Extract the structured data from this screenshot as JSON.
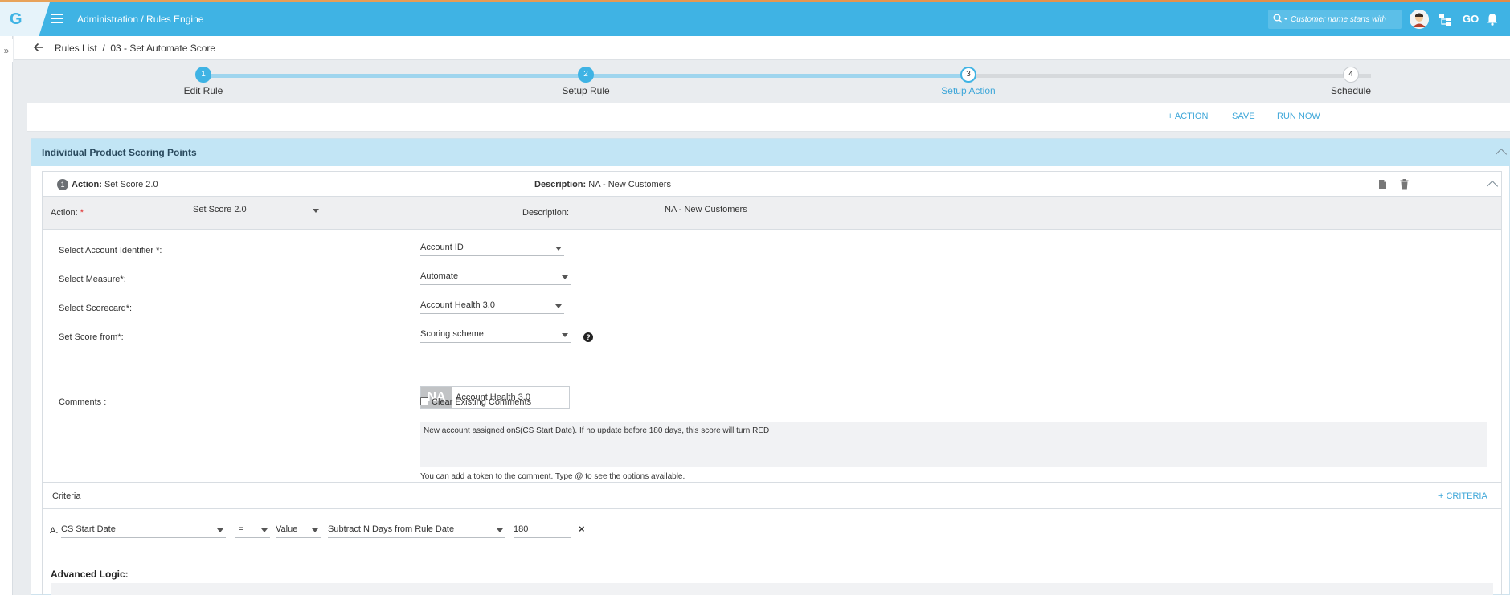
{
  "header": {
    "logo": "G",
    "breadcrumb": "Administration / Rules Engine",
    "search_placeholder": "Customer name starts with",
    "go_label": "GO"
  },
  "breadcrumb_bar": {
    "text": "Rules List  /  03 - Set Automate Score"
  },
  "stepper": {
    "steps": [
      {
        "num": "1",
        "label": "Edit Rule",
        "state": "done"
      },
      {
        "num": "2",
        "label": "Setup Rule",
        "state": "done"
      },
      {
        "num": "3",
        "label": "Setup Action",
        "state": "active"
      },
      {
        "num": "4",
        "label": "Schedule",
        "state": "todo"
      }
    ]
  },
  "actions": {
    "add_action": "+ ACTION",
    "save": "SAVE",
    "run_now": "RUN NOW"
  },
  "panel": {
    "title": "Individual Product Scoring Points"
  },
  "card": {
    "badge": "1",
    "action_label": "Action:",
    "action_value": "Set Score 2.0",
    "description_label": "Description:",
    "description_value": "NA - New Customers",
    "sub": {
      "action_label": "Action:",
      "action_req": "*",
      "action_value": "Set Score 2.0",
      "description_label": "Description:",
      "description_value": "NA - New Customers"
    },
    "fields": {
      "account_identifier_label": "Select Account Identifier *:",
      "account_identifier_value": "Account ID",
      "measure_label": "Select Measure*:",
      "measure_value": "Automate",
      "scorecard_label": "Select Scorecard*:",
      "scorecard_value": "Account Health 3.0",
      "score_from_label": "Set Score from*:",
      "score_from_value": "Scoring scheme",
      "help_glyph": "?",
      "na_badge": "NA",
      "na_value": "Account Health 3.0",
      "comments_label": "Comments :",
      "clear_comments_label": "Clear Existing Comments",
      "clear_comments_checked": false,
      "comments_text": "New account assigned on$(CS Start Date). If no update before 180 days, this score will turn RED",
      "comments_hint": "You can add a token to the comment. Type @ to see the options available."
    }
  },
  "criteria": {
    "title": "Criteria",
    "add_label": "+ CRITERIA",
    "row": {
      "letter": "A.",
      "field": "CS Start Date",
      "operator": "=",
      "value_type": "Value",
      "function": "Subtract N Days from Rule Date",
      "value": "180",
      "remove": "×"
    },
    "advanced_label": "Advanced Logic:"
  },
  "colors": {
    "header": "#3fb3e4",
    "accent": "#3fa7d9",
    "panel_header": "#c2e5f5"
  }
}
